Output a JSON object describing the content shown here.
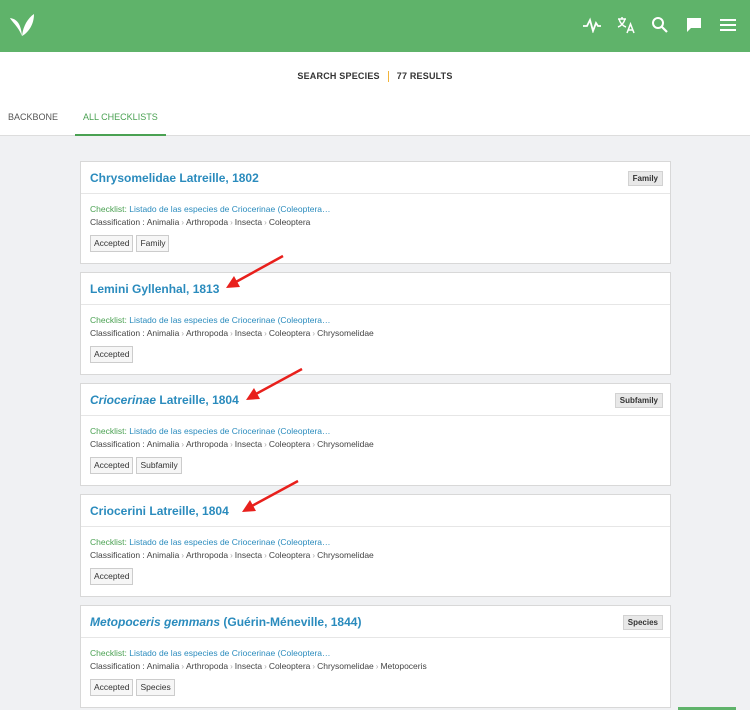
{
  "header": {
    "icons": [
      "logo-leaf",
      "activity-icon",
      "translate-icon",
      "search-icon",
      "feedback-icon",
      "menu-icon"
    ]
  },
  "search_summary": {
    "label": "SEARCH SPECIES",
    "results": "77 RESULTS"
  },
  "tabs": [
    {
      "label": "BACKBONE",
      "active": false
    },
    {
      "label": "ALL CHECKLISTS",
      "active": true
    }
  ],
  "results": [
    {
      "name": "Chrysomelidae",
      "italic": false,
      "author": "Latreille, 1802",
      "rank": "Family",
      "checklist_label": "Checklist:",
      "checklist": "Listado de las especies de Criocerinae (Coleoptera…",
      "classification_label": "Classification :",
      "classification": [
        "Animalia",
        "Arthropoda",
        "Insecta",
        "Coleoptera"
      ],
      "tags": [
        "Accepted",
        "Family"
      ]
    },
    {
      "name": "Lemini",
      "italic": false,
      "author": "Gyllenhal, 1813",
      "rank": "",
      "checklist_label": "Checklist:",
      "checklist": "Listado de las especies de Criocerinae (Coleoptera…",
      "classification_label": "Classification :",
      "classification": [
        "Animalia",
        "Arthropoda",
        "Insecta",
        "Coleoptera",
        "Chrysomelidae"
      ],
      "tags": [
        "Accepted"
      ]
    },
    {
      "name": "Criocerinae",
      "italic": true,
      "author": "Latreille, 1804",
      "rank": "Subfamily",
      "checklist_label": "Checklist:",
      "checklist": "Listado de las especies de Criocerinae (Coleoptera…",
      "classification_label": "Classification :",
      "classification": [
        "Animalia",
        "Arthropoda",
        "Insecta",
        "Coleoptera",
        "Chrysomelidae"
      ],
      "tags": [
        "Accepted",
        "Subfamily"
      ]
    },
    {
      "name": "Criocerini",
      "italic": false,
      "author": "Latreille, 1804",
      "rank": "",
      "checklist_label": "Checklist:",
      "checklist": "Listado de las especies de Criocerinae (Coleoptera…",
      "classification_label": "Classification :",
      "classification": [
        "Animalia",
        "Arthropoda",
        "Insecta",
        "Coleoptera",
        "Chrysomelidae"
      ],
      "tags": [
        "Accepted"
      ]
    },
    {
      "name": "Metopoceris gemmans",
      "italic": true,
      "author": "(Guérin-Méneville, 1844)",
      "rank": "Species",
      "checklist_label": "Checklist:",
      "checklist": "Listado de las especies de Criocerinae (Coleoptera…",
      "classification_label": "Classification :",
      "classification": [
        "Animalia",
        "Arthropoda",
        "Insecta",
        "Coleoptera",
        "Chrysomelidae",
        "Metopoceris"
      ],
      "tags": [
        "Accepted",
        "Species"
      ]
    }
  ],
  "colors": {
    "header": "#5fb36a",
    "link": "#2a8bbd",
    "green_text": "#4aa152",
    "annotation_arrow": "#e8201c"
  }
}
